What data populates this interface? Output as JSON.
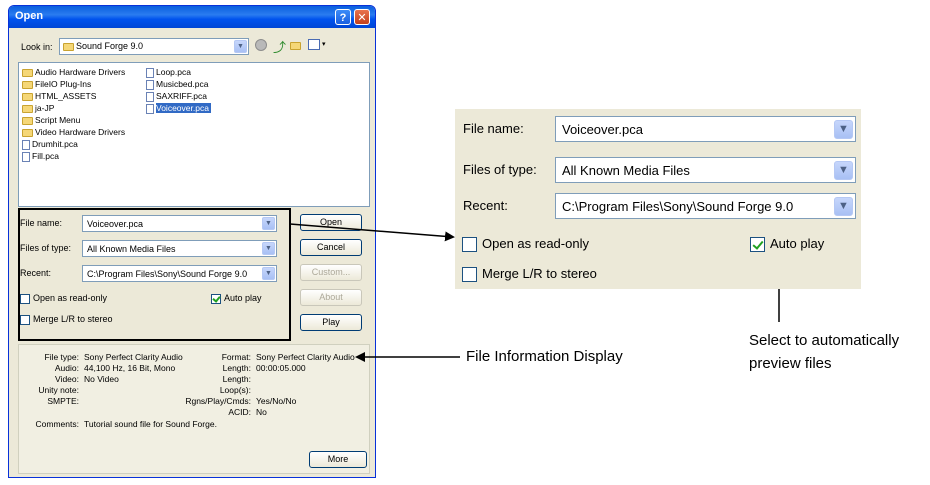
{
  "dialog": {
    "title": "Open",
    "help_label": "?",
    "close_label": "✕",
    "look_in_label": "Look in:",
    "look_in_value": "Sound Forge 9.0",
    "files_col1": [
      {
        "name": "Audio Hardware Drivers",
        "icon": "folder-icon"
      },
      {
        "name": "FileIO Plug-Ins",
        "icon": "folder-icon"
      },
      {
        "name": "HTML_ASSETS",
        "icon": "folder-icon"
      },
      {
        "name": "ja-JP",
        "icon": "folder-icon"
      },
      {
        "name": "Script Menu",
        "icon": "folder-icon"
      },
      {
        "name": "Video Hardware Drivers",
        "icon": "folder-icon"
      },
      {
        "name": "Drumhit.pca",
        "icon": "file-icon"
      },
      {
        "name": "Fill.pca",
        "icon": "file-icon"
      }
    ],
    "files_col2": [
      {
        "name": "Loop.pca",
        "icon": "file-icon"
      },
      {
        "name": "Musicbed.pca",
        "icon": "file-icon"
      },
      {
        "name": "SAXRIFF.pca",
        "icon": "file-icon"
      },
      {
        "name": "Voiceover.pca",
        "icon": "file-icon",
        "selected": true
      }
    ],
    "file_name_label": "File name:",
    "file_name_value": "Voiceover.pca",
    "files_of_type_label": "Files of type:",
    "files_of_type_value": "All Known Media Files",
    "recent_label": "Recent:",
    "recent_value": "C:\\Program Files\\Sony\\Sound Forge 9.0",
    "open_read_only_label": "Open as read-only",
    "auto_play_label": "Auto play",
    "merge_label": "Merge L/R to stereo",
    "buttons": {
      "open": "Open",
      "cancel": "Cancel",
      "custom": "Custom...",
      "about": "About",
      "play": "Play",
      "more": "More"
    },
    "info": {
      "file_type_label": "File type:",
      "file_type_value": "Sony Perfect Clarity Audio",
      "audio_label": "Audio:",
      "audio_value": "44,100 Hz, 16 Bit, Mono",
      "video_label": "Video:",
      "video_value": "No Video",
      "unity_note_label": "Unity note:",
      "smpte_label": "SMPTE:",
      "comments_label": "Comments:",
      "comments_value": "Tutorial sound file for Sound Forge.",
      "format_label": "Format:",
      "format_value": "Sony Perfect Clarity Audio",
      "length_label": "Length:",
      "length_value": "00:00:05.000",
      "length2_label": "Length:",
      "loops_label": "Loop(s):",
      "rgns_label": "Rgns/Play/Cmds:",
      "rgns_value": "Yes/No/No",
      "acid_label": "ACID:",
      "acid_value": "No"
    }
  },
  "checkboxes": {
    "open_read_only": false,
    "auto_play": true,
    "merge": false
  },
  "callouts": {
    "file_info": "File Information Display",
    "auto_play_line1": "Select to automatically",
    "auto_play_line2": "preview files"
  }
}
